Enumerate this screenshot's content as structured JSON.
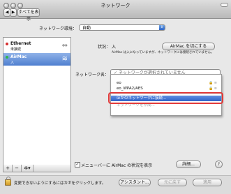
{
  "window": {
    "title": "ネットワーク"
  },
  "toolbar": {
    "show_all": "すべてを表示"
  },
  "location": {
    "label": "ネットワーク環境：",
    "value": "自動"
  },
  "sidebar": {
    "services": [
      {
        "name": "Ethernet",
        "sub": "未接続",
        "status_color": "#d62f2f",
        "icon": "ethernet-arrows-icon"
      },
      {
        "name": "AirMac",
        "sub": "入",
        "status_color": "#2fb84a",
        "icon": "wifi-icon"
      }
    ],
    "add": "+",
    "remove": "−",
    "gear": "✲▾"
  },
  "detail": {
    "status_label": "状況：",
    "status_value": "入",
    "airmac_off_button": "AirMac を切にする",
    "description": "AirMac は入になっていますが、ネットワークには接続されていません。",
    "network_name_label": "ネットワーク名：",
    "network_menu": {
      "current": "✓ ネットワークが選択されていません",
      "items": [
        {
          "label": "eo",
          "lock": "🔒 ≋"
        },
        {
          "label": "eo_WPA2/AES",
          "lock": "🔒 ≋"
        }
      ],
      "highlighted": "ほかのネットワークに接続...",
      "create": "ネットワークを作成..."
    },
    "menubar_checkbox": {
      "checked": true,
      "label": "メニューバーに AirMac の状況を表示"
    },
    "advanced_button": "詳細...",
    "help_button": "?"
  },
  "bottom": {
    "lock_text": "変更できないようにするにはカギをクリックします。",
    "assistant": "アシスタント...",
    "revert": "元に戻す",
    "apply": "適用"
  }
}
